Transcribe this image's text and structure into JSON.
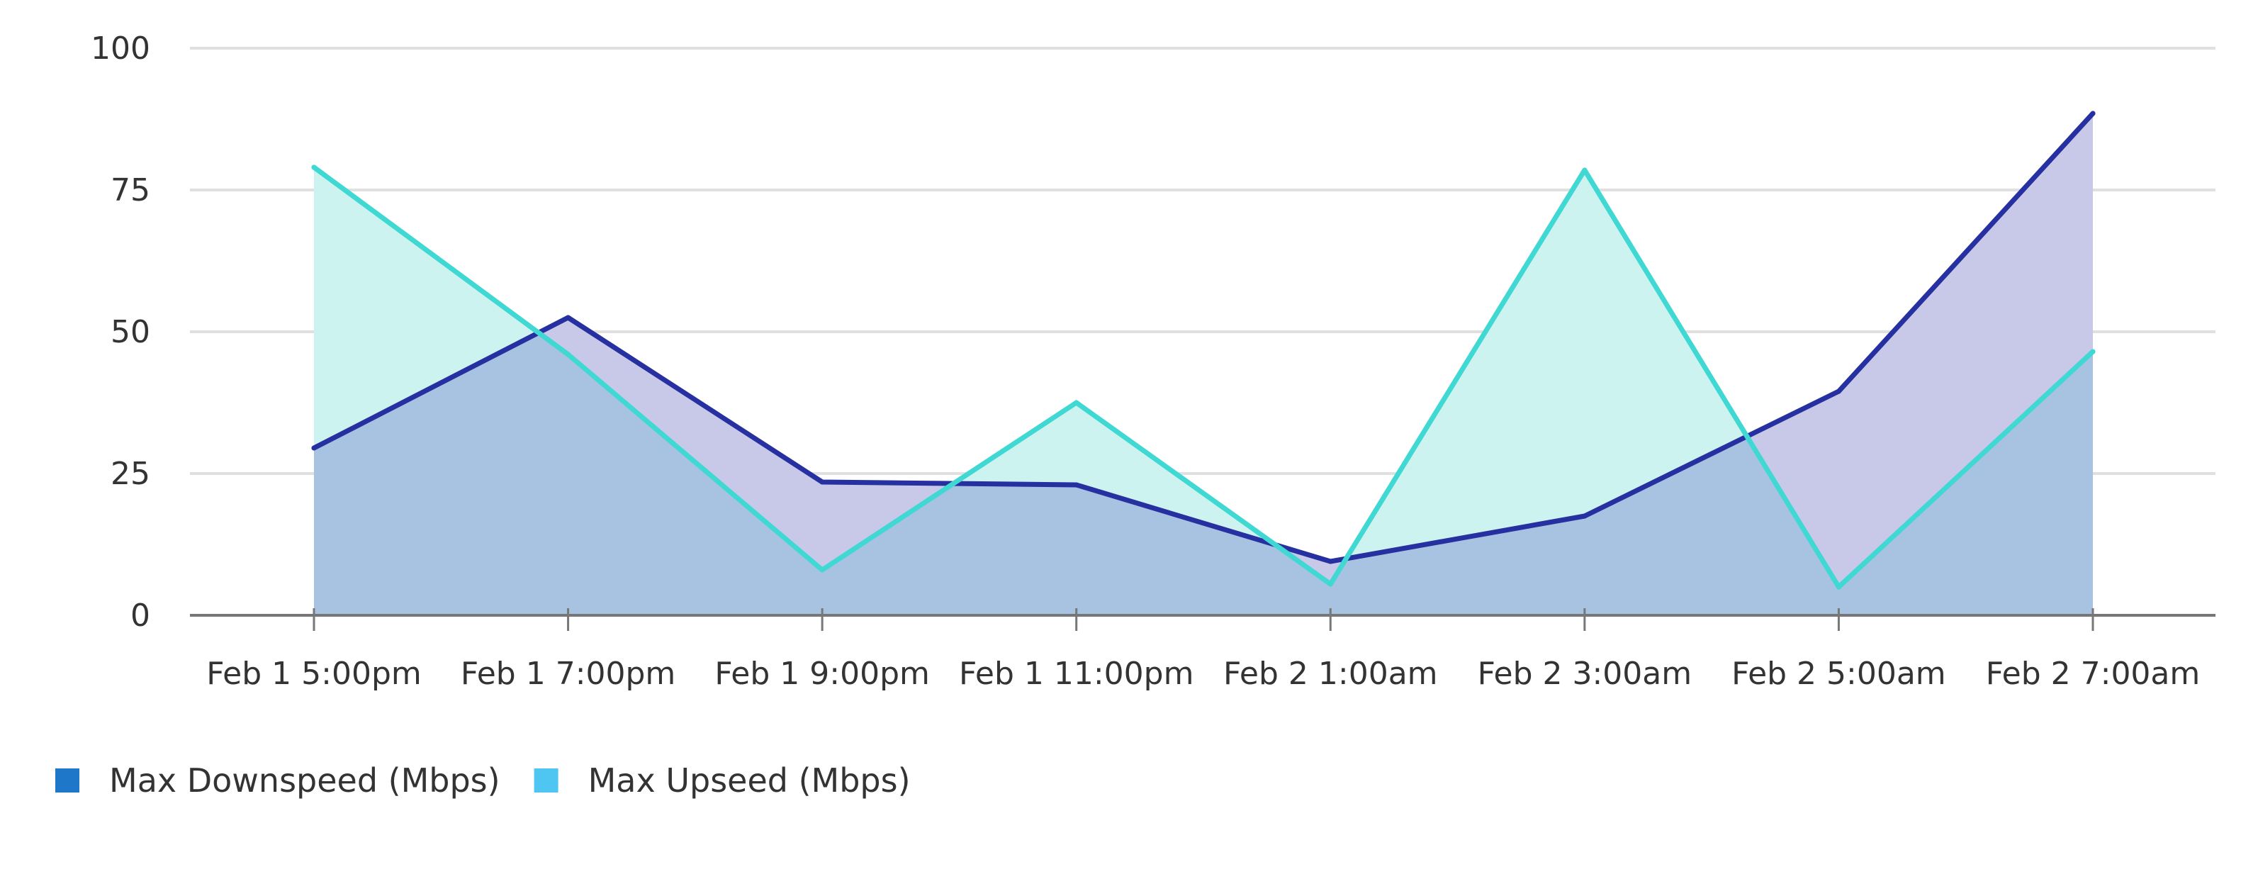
{
  "chart_data": {
    "type": "area",
    "title": "",
    "xlabel": "",
    "ylabel": "",
    "categories": [
      "Feb 1 5:00pm",
      "Feb 1 7:00pm",
      "Feb 1 9:00pm",
      "Feb 1 11:00pm",
      "Feb 2 1:00am",
      "Feb 2 3:00am",
      "Feb 2 5:00am",
      "Feb 2 7:00am"
    ],
    "ylim": [
      0,
      100
    ],
    "yticks": [
      0,
      25,
      50,
      75,
      100
    ],
    "grid": true,
    "legend_position": "bottom-left",
    "series": [
      {
        "name": "Max Downspeed (Mbps)",
        "values": [
          29.5,
          52.5,
          23.5,
          23,
          9.5,
          17.5,
          39.5,
          88.5
        ],
        "line_color": "#2730a0",
        "fill_color": "#c8c8e8",
        "legend_color": "#1f77c9"
      },
      {
        "name": "Max Upseed (Mbps)",
        "values": [
          79,
          46,
          8,
          37.5,
          5.5,
          78.5,
          5,
          46.5
        ],
        "line_color": "#3fd8d2",
        "fill_color": "#cdf3f1",
        "legend_color": "#4fc6f2"
      }
    ],
    "overlap_color": "#a7c3e1",
    "axis_color": "#777777",
    "grid_color": "#e0e0e0"
  }
}
